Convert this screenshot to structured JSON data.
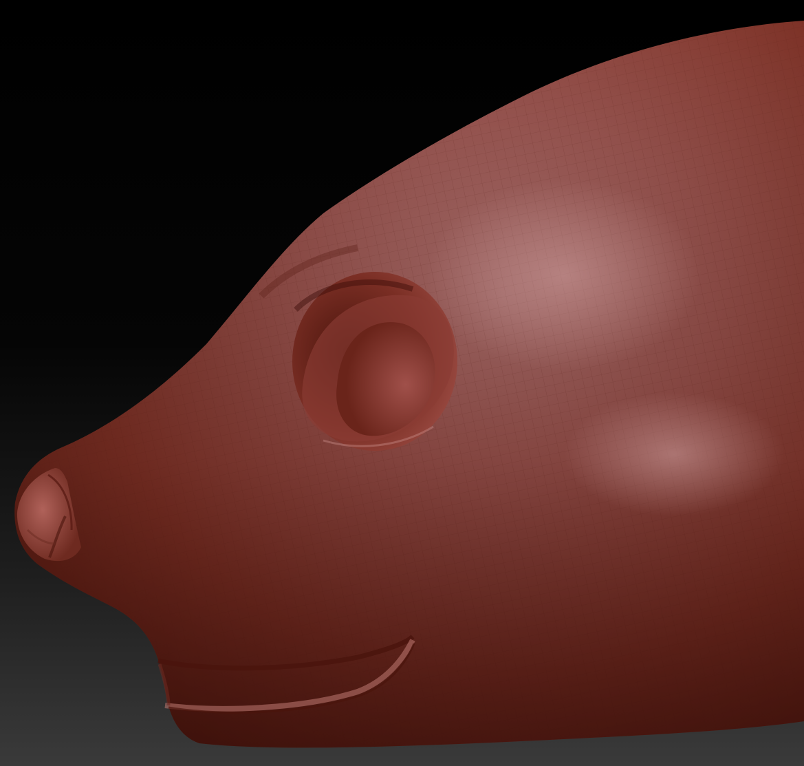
{
  "viewport": {
    "background_top": "#000000",
    "background_bottom": "#3a3a3a"
  },
  "model": {
    "subject": "sculpt-head",
    "material_color": "#9a4a40",
    "highlight_color": "#c48a86",
    "shadow_color": "#4a1a14",
    "wireframe_color": "#5a1e18"
  }
}
